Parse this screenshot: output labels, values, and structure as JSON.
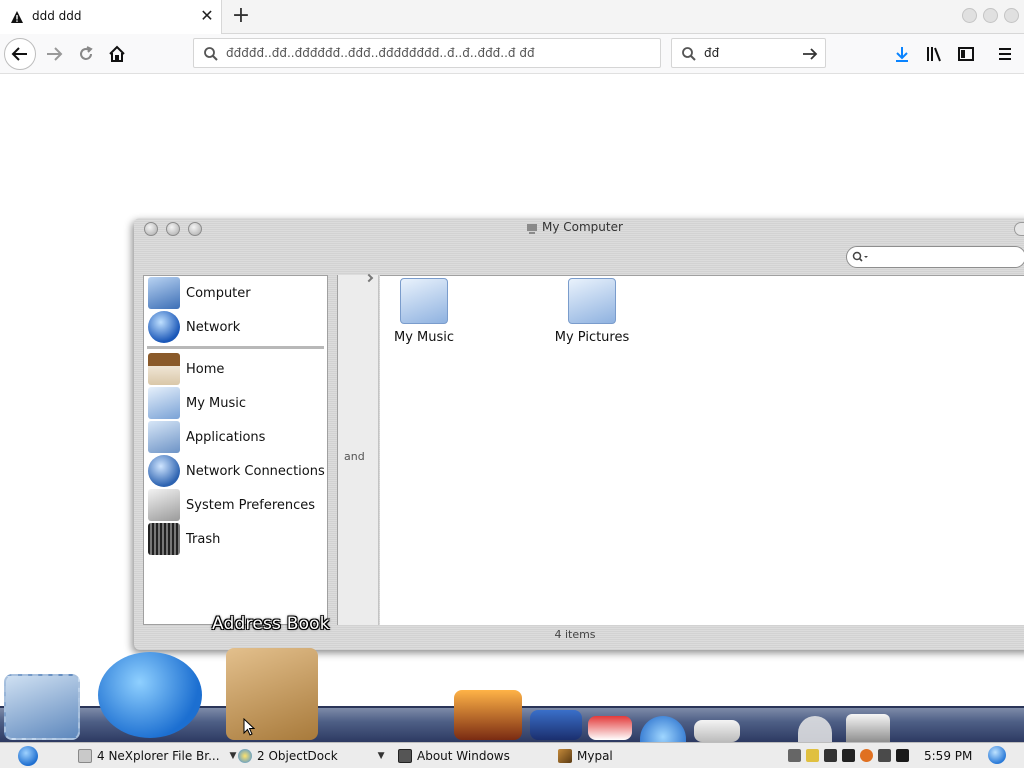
{
  "browser": {
    "tab_title": "ddd ddd",
    "url_text": "đđđđđ..đđ..đđđđđđ..đđđ..đđđđđđđđ..đ..đ..đđđ..đ  đđ",
    "search_value": "đđ",
    "colors": {
      "download": "#0a84ff",
      "chrome_bg": "#f9f9fa"
    }
  },
  "finder": {
    "title": "My Computer",
    "sidebar_items": [
      {
        "label": "Computer",
        "icon": "computer-icon"
      },
      {
        "label": "Network",
        "icon": "globe-icon"
      },
      {
        "label": "Home",
        "icon": "home-icon"
      },
      {
        "label": "My Music",
        "icon": "music-folder-icon"
      },
      {
        "label": "Applications",
        "icon": "applications-icon"
      },
      {
        "label": "Network Connections",
        "icon": "network-connections-icon"
      },
      {
        "label": "System Preferences",
        "icon": "system-preferences-icon"
      },
      {
        "label": "Trash",
        "icon": "trash-icon"
      }
    ],
    "column_fragment": "and",
    "files": [
      {
        "label": "My Music",
        "icon": "music-folder-icon"
      },
      {
        "label": "My Pictures",
        "icon": "pictures-folder-icon"
      }
    ],
    "status": "4 items"
  },
  "dock": {
    "hover_label": "Address Book"
  },
  "taskbar": {
    "items": [
      {
        "label": "4  NeXplorer File Br...",
        "icon": "explorer-icon"
      },
      {
        "label": "2  ObjectDock",
        "icon": "objectdock-icon"
      },
      {
        "label": "About Windows",
        "icon": "window-icon"
      },
      {
        "label": "Mypal",
        "icon": "mypal-icon"
      }
    ],
    "clock": "5:59 PM"
  }
}
